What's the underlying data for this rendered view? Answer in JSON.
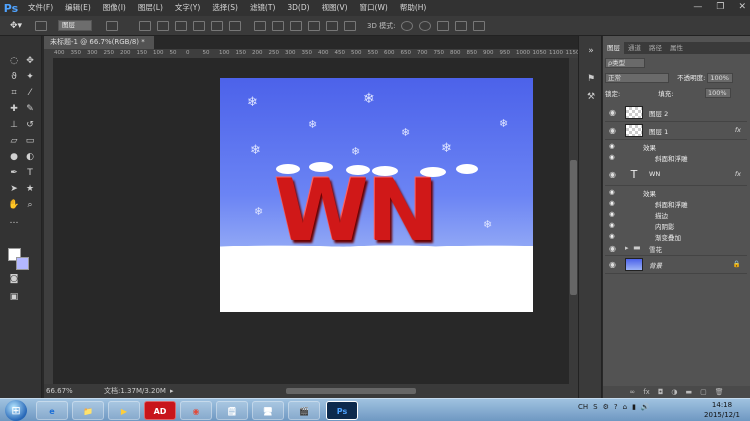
{
  "app": {
    "logo": "Ps"
  },
  "menu": [
    "文件(F)",
    "编辑(E)",
    "图像(I)",
    "图层(L)",
    "文字(Y)",
    "选择(S)",
    "滤镜(T)",
    "3D(D)",
    "视图(V)",
    "窗口(W)",
    "帮助(H)"
  ],
  "window_controls": {
    "minimize": "—",
    "restore": "❐",
    "close": "✕"
  },
  "options": {
    "mode_select": "图层",
    "mode_3d": "3D 模式:"
  },
  "document": {
    "tab_title": "未标题-1 @ 66.7%(RGB/8) *",
    "canvas_text": "WN",
    "ruler_ticks": [
      "400",
      "350",
      "300",
      "250",
      "200",
      "150",
      "100",
      "50",
      "0",
      "50",
      "100",
      "150",
      "200",
      "250",
      "300",
      "350",
      "400",
      "450",
      "500",
      "550",
      "600",
      "650",
      "700",
      "750",
      "800",
      "850",
      "900",
      "950",
      "1000",
      "1050",
      "1100",
      "1150"
    ]
  },
  "status": {
    "zoom": "66.67%",
    "doc_info": "文档:1.37M/3.20M"
  },
  "panel": {
    "tabs": [
      "图层",
      "通道",
      "路径",
      "属性"
    ],
    "kind_filter": "ρ类型",
    "blend_mode": "正常",
    "opacity_label": "不透明度:",
    "opacity_value": "100%",
    "lock_label": "锁定:",
    "fill_label": "填充:",
    "fill_value": "100%",
    "layers": [
      {
        "name": "图层 2",
        "fx": ""
      },
      {
        "name": "图层 1",
        "fx": "fx",
        "effects_label": "效果",
        "effects": [
          "斜面和浮雕"
        ]
      },
      {
        "name": "WN",
        "fx": "fx",
        "effects_label": "效果",
        "effects": [
          "斜面和浮雕",
          "描边",
          "内阴影",
          "渐变叠加"
        ]
      },
      {
        "name": "雪花",
        "fx": ""
      },
      {
        "name": "背景",
        "fx": ""
      }
    ]
  },
  "taskbar": {
    "apps": [
      "e",
      "📁",
      "▶",
      "AD",
      "◉",
      "🗒",
      "🖥",
      "🎬",
      "Ps"
    ],
    "tray": [
      "CH",
      "S",
      "⚙",
      "?",
      "⌂",
      "▮",
      "🔊"
    ],
    "clock_time": "14:18",
    "clock_date": "2015/12/1"
  },
  "colors": {
    "accent": "#4fa3ff",
    "canvas_top": "#4c62ea",
    "letters": "#d01818",
    "bg_swatch": "#b3b8ff"
  }
}
